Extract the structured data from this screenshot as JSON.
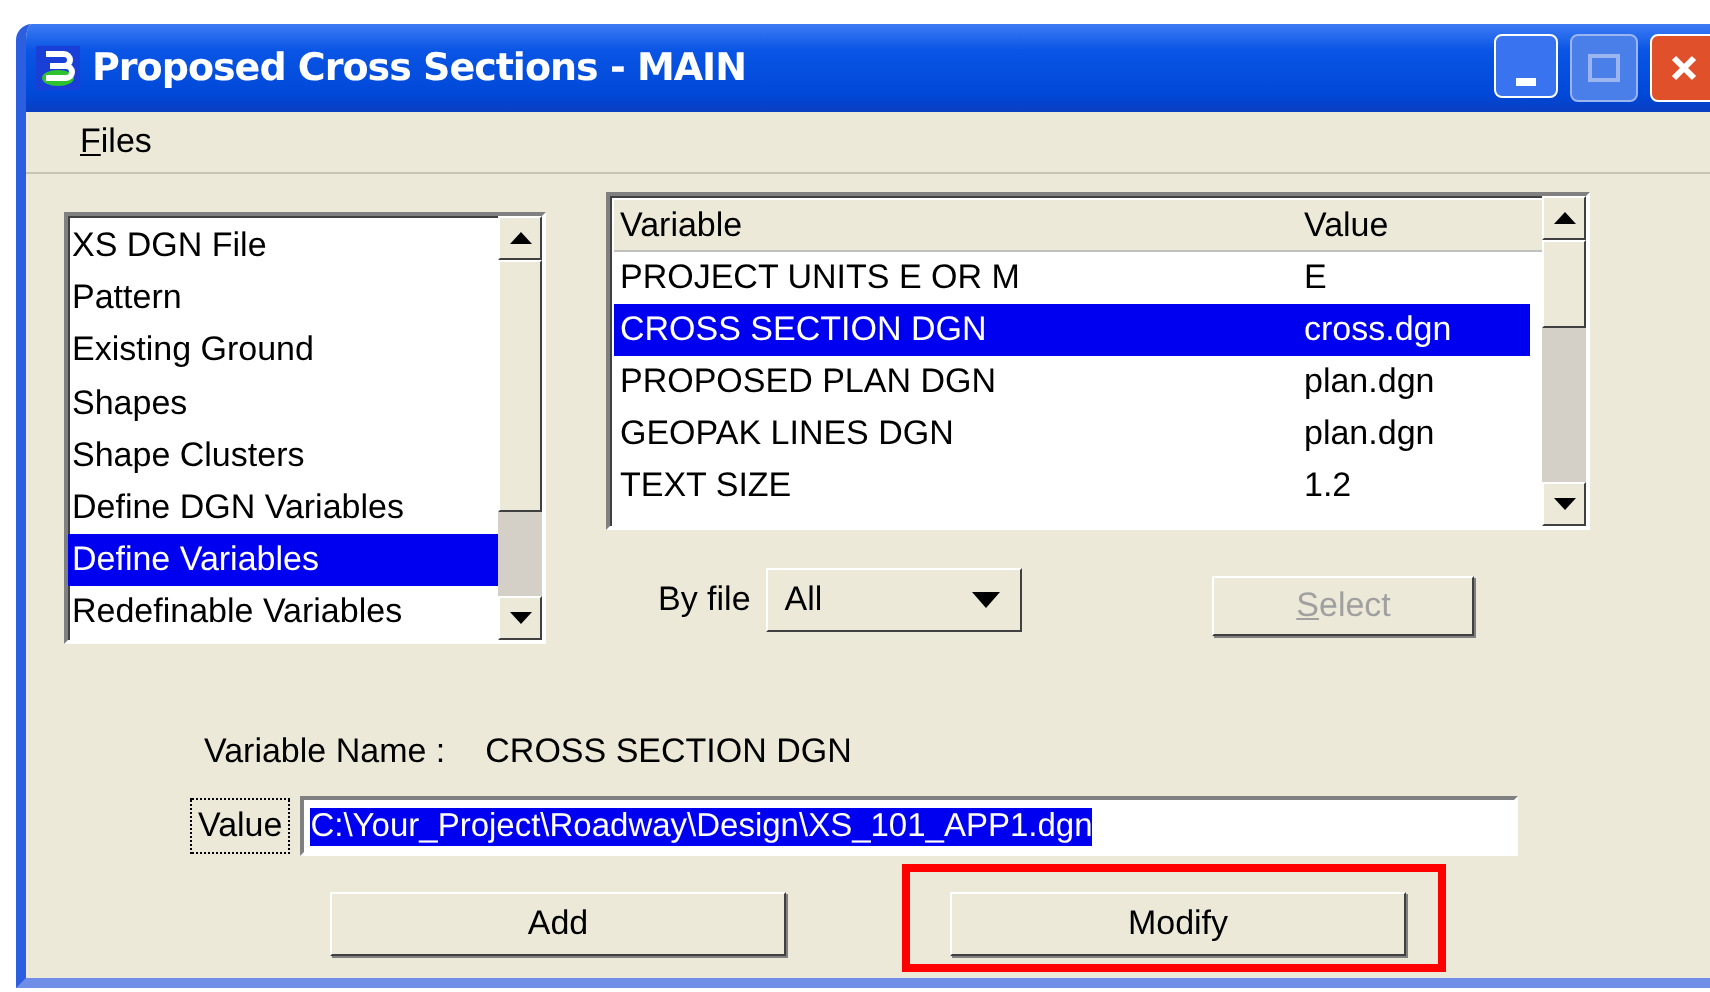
{
  "window": {
    "title": "Proposed Cross Sections - MAIN"
  },
  "menu": [
    {
      "label": "Files",
      "mnemonic": true
    }
  ],
  "categories": [
    {
      "label": "XS DGN File",
      "selected": false
    },
    {
      "label": "Pattern",
      "selected": false
    },
    {
      "label": "Existing Ground",
      "selected": false
    },
    {
      "label": "Shapes",
      "selected": false
    },
    {
      "label": "Shape Clusters",
      "selected": false
    },
    {
      "label": "Define DGN Variables",
      "selected": false
    },
    {
      "label": "Define Variables",
      "selected": true
    },
    {
      "label": "Redefinable Variables",
      "selected": false
    }
  ],
  "table": {
    "columns": [
      "Variable",
      "Value"
    ],
    "rows": [
      {
        "cells": [
          "PROJECT UNITS E OR M",
          "E"
        ],
        "selected": false
      },
      {
        "cells": [
          "CROSS SECTION DGN",
          "cross.dgn"
        ],
        "selected": true
      },
      {
        "cells": [
          "PROPOSED PLAN DGN",
          "plan.dgn"
        ],
        "selected": false
      },
      {
        "cells": [
          "GEOPAK LINES DGN",
          "plan.dgn"
        ],
        "selected": false
      },
      {
        "cells": [
          "TEXT SIZE",
          "1.2"
        ],
        "selected": false
      }
    ]
  },
  "by_file": {
    "label": "By file",
    "value": "All"
  },
  "select_button": {
    "label": "Select",
    "disabled": true,
    "mnemonic": true
  },
  "variable_name": {
    "label": "Variable Name :",
    "value": "CROSS SECTION DGN"
  },
  "value_field": {
    "label": "Value",
    "value": "C:\\Your_Project\\Roadway\\Design\\XS_101_APP1.dgn",
    "selected": true
  },
  "buttons": [
    {
      "label": "Add",
      "highlighted": false
    },
    {
      "label": "Modify",
      "highlighted": true
    }
  ]
}
